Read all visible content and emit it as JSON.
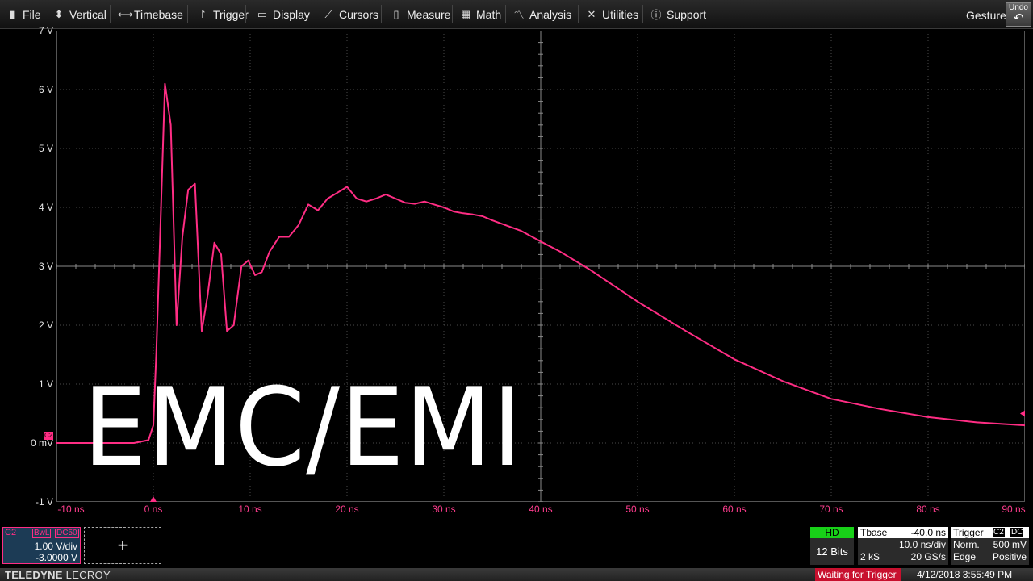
{
  "menu": {
    "items": [
      {
        "label": "File",
        "icon": "clipboard-icon",
        "glyph": "▮"
      },
      {
        "label": "Vertical",
        "icon": "vertical-arrows-icon",
        "glyph": "⬍"
      },
      {
        "label": "Timebase",
        "icon": "horizontal-arrows-icon",
        "glyph": "⟷"
      },
      {
        "label": "Trigger",
        "icon": "trigger-flag-icon",
        "glyph": "↾"
      },
      {
        "label": "Display",
        "icon": "display-icon",
        "glyph": "▭"
      },
      {
        "label": "Cursors",
        "icon": "cursor-icon",
        "glyph": "⟋"
      },
      {
        "label": "Measure",
        "icon": "measure-icon",
        "glyph": "▯"
      },
      {
        "label": "Math",
        "icon": "calculator-icon",
        "glyph": "▦"
      },
      {
        "label": "Analysis",
        "icon": "analysis-chart-icon",
        "glyph": "〽"
      },
      {
        "label": "Utilities",
        "icon": "wrench-icon",
        "glyph": "✕"
      },
      {
        "label": "Support",
        "icon": "info-icon",
        "glyph": "ⓘ"
      }
    ],
    "gesture_label": "Gesture",
    "undo_label": "Undo"
  },
  "overlay_title": "EMC/EMI",
  "channel_marker": "C2",
  "chart_data": {
    "type": "line",
    "y_tick_labels": [
      "7 V",
      "6 V",
      "5 V",
      "4 V",
      "3 V",
      "2 V",
      "1 V",
      "0 mV",
      "-1 V"
    ],
    "x_tick_labels": [
      "-10 ns",
      "0 ns",
      "10 ns",
      "20 ns",
      "30 ns",
      "40 ns",
      "50 ns",
      "60 ns",
      "70 ns",
      "80 ns",
      "90 ns"
    ],
    "xlim": [
      -10,
      90
    ],
    "ylim": [
      -1,
      7
    ],
    "grid": true,
    "color": "#ff2d84",
    "series": [
      {
        "x": [
          -10,
          -2,
          -0.5,
          0,
          0.3,
          0.7,
          1.2,
          1.8,
          2.4,
          3.0,
          3.6,
          4.3,
          5.0,
          5.6,
          6.3,
          7.0,
          7.6,
          8.3,
          9.1,
          9.8,
          10.5,
          11.2,
          12.0,
          13.0,
          14.0,
          15.0,
          16.0,
          17.0,
          18.0,
          19.0,
          20.0,
          21.0,
          22.0,
          23.0,
          24.0,
          25.0,
          26.0,
          27.0,
          28.0,
          29.0,
          30.0,
          31.0,
          32.0,
          33.0,
          34.0,
          35.0,
          36.0,
          38.0,
          40.0,
          42.0,
          45.0,
          50.0,
          55.0,
          60.0,
          65.0,
          70.0,
          75.0,
          80.0,
          85.0,
          90.0
        ],
        "y": [
          0.0,
          0.0,
          0.05,
          0.3,
          1.5,
          3.5,
          6.1,
          5.4,
          2.0,
          3.5,
          4.3,
          4.4,
          1.9,
          2.5,
          3.4,
          3.2,
          1.9,
          2.0,
          3.0,
          3.1,
          2.85,
          2.9,
          3.25,
          3.5,
          3.5,
          3.7,
          4.05,
          3.95,
          4.15,
          4.25,
          4.35,
          4.15,
          4.1,
          4.15,
          4.22,
          4.15,
          4.08,
          4.06,
          4.1,
          4.05,
          4.0,
          3.93,
          3.9,
          3.88,
          3.85,
          3.78,
          3.72,
          3.6,
          3.42,
          3.25,
          2.95,
          2.4,
          1.9,
          1.42,
          1.05,
          0.75,
          0.58,
          0.44,
          0.35,
          0.3
        ]
      }
    ]
  },
  "channel": {
    "name": "C2",
    "bandwidth": "BwL",
    "coupling": "DC50",
    "vdiv": "1.00 V/div",
    "offset": "-3.0000 V"
  },
  "add_symbol": "+",
  "hd": {
    "label": "HD",
    "bits": "12 Bits"
  },
  "timebase": {
    "label": "Tbase",
    "delay": "-40.0 ns",
    "tdiv": "10.0 ns/div",
    "samples": "2 kS",
    "rate": "20 GS/s"
  },
  "trigger": {
    "label": "Trigger",
    "source": "C2",
    "coupling": "DC",
    "mode": "Norm.",
    "level": "500 mV",
    "type": "Edge",
    "slope": "Positive"
  },
  "status": {
    "brand_bold": "TELEDYNE",
    "brand_rest": " LECROY",
    "message": "Waiting for Trigger",
    "datetime": "4/12/2018 3:55:49 PM"
  }
}
